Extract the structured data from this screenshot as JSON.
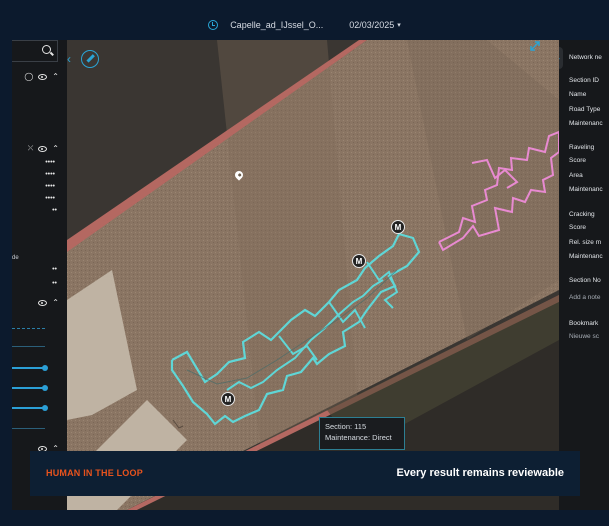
{
  "topbar": {
    "project": "Capelle_ad_IJssel_O...",
    "date": "02/03/2025",
    "caret": "▾"
  },
  "left_panel": {
    "icons": [
      "search-icon",
      "drop-icon",
      "eye-icon",
      "chevron-up-icon",
      "filter-off-icon"
    ],
    "stub_text": "de",
    "dots": "••••"
  },
  "map": {
    "tooltip": {
      "section": "Section: 115",
      "maintenance": "Maintenance: Direct"
    },
    "markers": [
      "M",
      "M",
      "M"
    ]
  },
  "right_panel": {
    "items": [
      {
        "text": "Network ne",
        "kind": "head"
      },
      {
        "text": "Section ID",
        "kind": "label"
      },
      {
        "text": "Name",
        "kind": "label"
      },
      {
        "text": "Road Type",
        "kind": "label"
      },
      {
        "text": "Maintenanc",
        "kind": "label"
      },
      {
        "text": "Raveling",
        "kind": "head"
      },
      {
        "text": "Score",
        "kind": "label"
      },
      {
        "text": "Area",
        "kind": "label"
      },
      {
        "text": "Maintenanc",
        "kind": "label"
      },
      {
        "text": "Cracking",
        "kind": "head"
      },
      {
        "text": "Score",
        "kind": "label"
      },
      {
        "text": "Rel. size m",
        "kind": "label"
      },
      {
        "text": "Maintenanc",
        "kind": "label"
      },
      {
        "text": "Section No",
        "kind": "head"
      },
      {
        "text": "Add a note",
        "kind": "dim"
      },
      {
        "text": "Bookmark",
        "kind": "head"
      },
      {
        "text": "Nieuwe sc",
        "kind": "dim"
      }
    ]
  },
  "banner": {
    "left": "HUMAN IN THE LOOP",
    "right": "Every result remains reviewable"
  },
  "colors": {
    "accent": "#2aa4d5",
    "cyan_outline": "#5fd6d6",
    "pink_outline": "#e88ad1",
    "banner_orange": "#e8531d"
  }
}
